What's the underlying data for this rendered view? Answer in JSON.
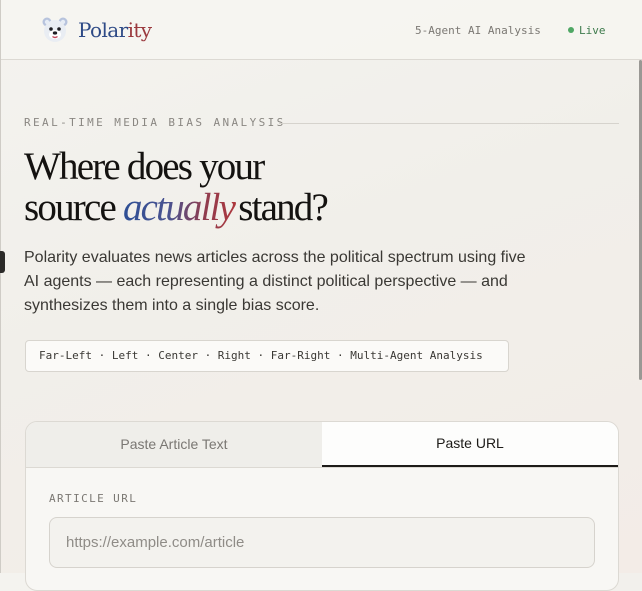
{
  "header": {
    "brand_part1": "Polar",
    "brand_part2": "ity",
    "agents_label": "5-Agent AI Analysis",
    "live_label": "Live"
  },
  "hero": {
    "eyebrow": "REAL-TIME MEDIA BIAS ANALYSIS",
    "headline_line1": "Where does your",
    "headline_line2_before": "source",
    "headline_line2_emphasis": "actually",
    "headline_line2_after": "stand?",
    "lede": "Polarity evaluates news articles across the political spectrum using five AI agents — each representing a distinct political perspective — and synthesizes them into a single bias score.",
    "spectrum": "Far-Left · Left · Center · Right · Far-Right · Multi-Agent Analysis"
  },
  "card": {
    "tabs": [
      {
        "label": "Paste Article Text",
        "active": false
      },
      {
        "label": "Paste URL",
        "active": true
      }
    ],
    "field_label": "ARTICLE URL",
    "url_placeholder": "https://example.com/article",
    "url_value": ""
  },
  "colors": {
    "brand_blue": "#2e4a86",
    "brand_red": "#9b3a3f",
    "live_green": "#4fa764"
  },
  "icons": {
    "logo": "bear-logo-icon",
    "live": "live-status-dot-icon"
  }
}
